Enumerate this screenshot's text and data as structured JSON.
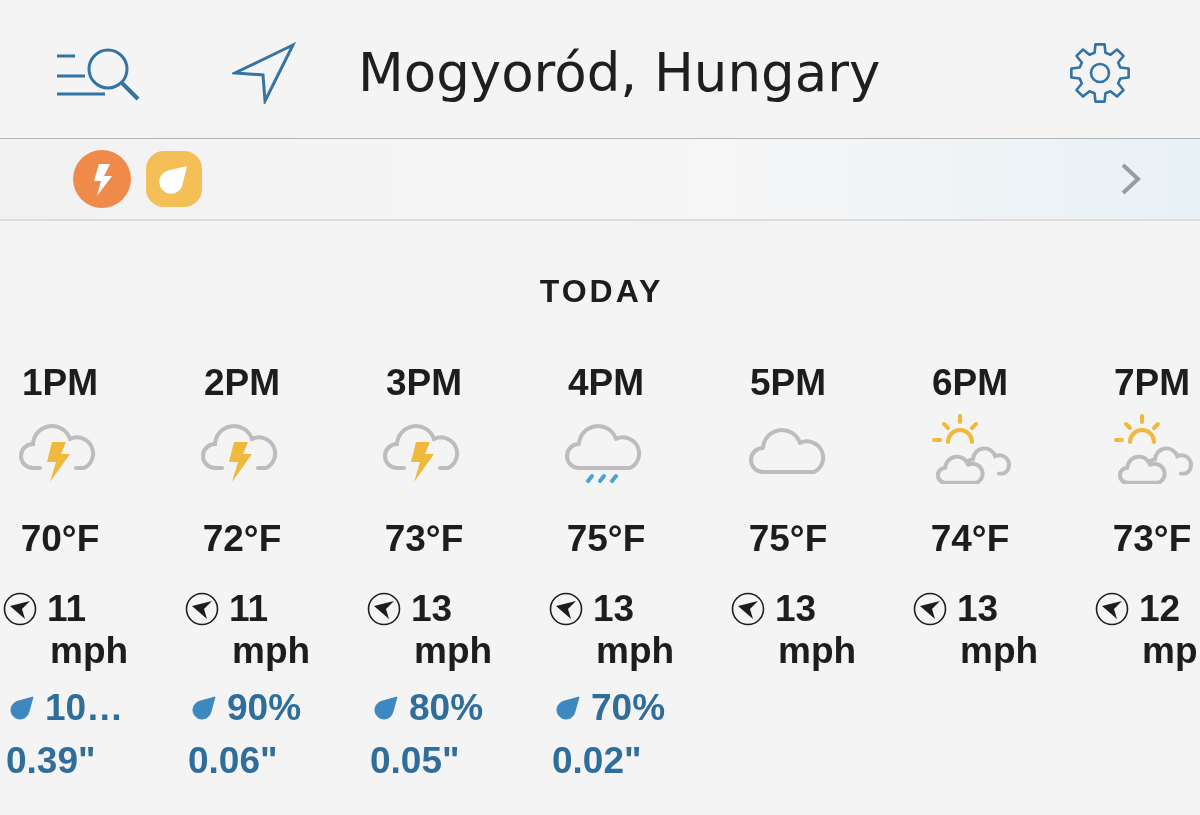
{
  "header": {
    "title": "Mogyoród, Hungary"
  },
  "alerts": [
    {
      "kind": "lightning",
      "color": "#ef8a4b"
    },
    {
      "kind": "leaf",
      "color": "#f4bf56"
    }
  ],
  "day_label": "TODAY",
  "hours": [
    {
      "time": "1PM",
      "kind": "thunderstorm",
      "temperature": "70°F",
      "wind_speed": "11",
      "wind_unit": "mph",
      "precip_chance": "10…",
      "precip_amount": "0.39\""
    },
    {
      "time": "2PM",
      "kind": "thunderstorm",
      "temperature": "72°F",
      "wind_speed": "11",
      "wind_unit": "mph",
      "precip_chance": "90%",
      "precip_amount": "0.06\""
    },
    {
      "time": "3PM",
      "kind": "thunderstorm",
      "temperature": "73°F",
      "wind_speed": "13",
      "wind_unit": "mph",
      "precip_chance": "80%",
      "precip_amount": "0.05\""
    },
    {
      "time": "4PM",
      "kind": "rain",
      "temperature": "75°F",
      "wind_speed": "13",
      "wind_unit": "mph",
      "precip_chance": "70%",
      "precip_amount": "0.02\""
    },
    {
      "time": "5PM",
      "kind": "cloudy",
      "temperature": "75°F",
      "wind_speed": "13",
      "wind_unit": "mph"
    },
    {
      "time": "6PM",
      "kind": "sun",
      "temperature": "74°F",
      "wind_speed": "13",
      "wind_unit": "mph"
    },
    {
      "time": "7PM",
      "kind": "sun",
      "temperature": "73°F",
      "wind_speed": "12",
      "wind_unit": "mp"
    }
  ]
}
